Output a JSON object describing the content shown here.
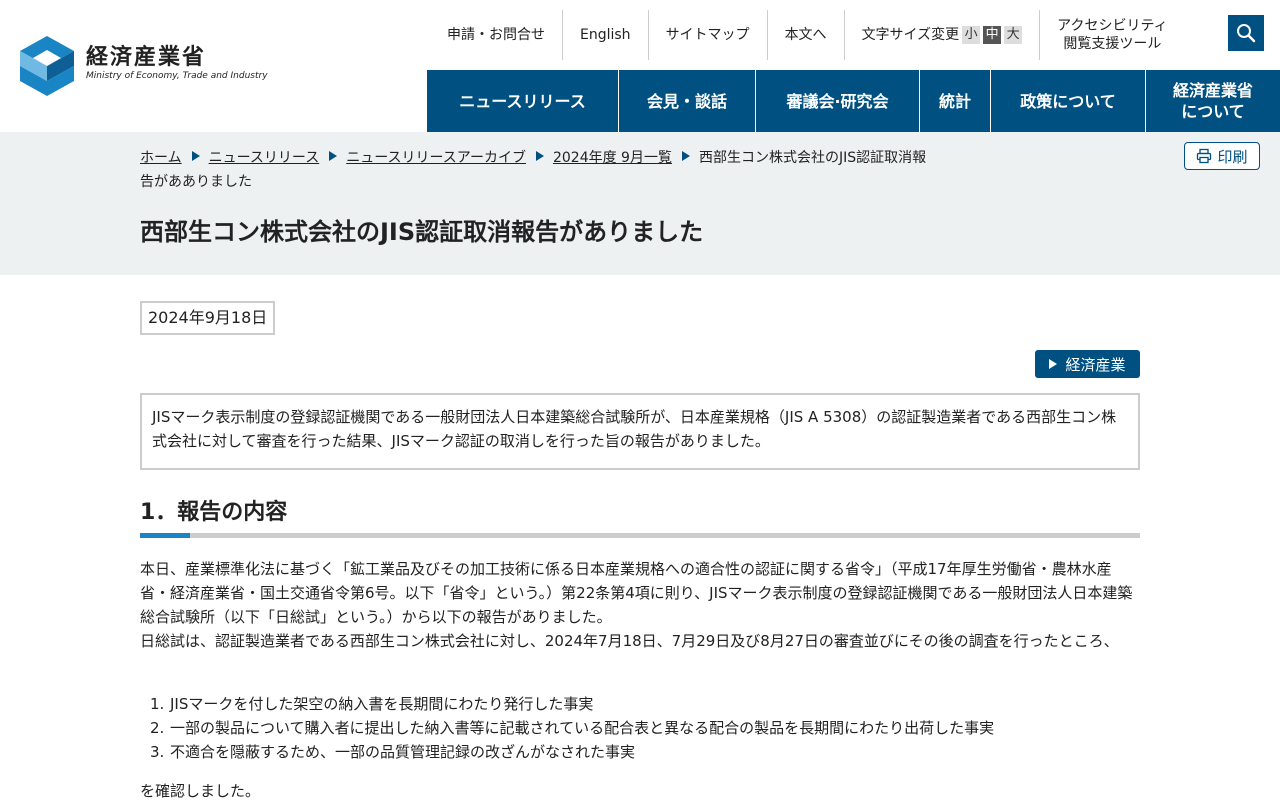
{
  "header": {
    "logo_ja": "経済産業省",
    "logo_en": "Ministry of Economy, Trade and Industry",
    "util": {
      "contact": "申請・お問合せ",
      "english": "English",
      "sitemap": "サイトマップ",
      "skip": "本文へ",
      "font_size_label": "文字サイズ変更",
      "font_small": "小",
      "font_medium": "中",
      "font_large": "大",
      "accessibility_line1": "アクセシビリティ",
      "accessibility_line2": "閲覧支援ツール"
    },
    "gnav": [
      {
        "label": "ニュースリリース"
      },
      {
        "label": "会見・談話"
      },
      {
        "label": "審議会·研究会"
      },
      {
        "label": "統計"
      },
      {
        "label": "政策について"
      },
      {
        "label_line1": "経済産業省",
        "label_line2": "について"
      }
    ]
  },
  "breadcrumb": {
    "items": [
      "ホーム",
      "ニュースリリース",
      "ニュースリリースアーカイブ",
      "2024年度 9月一覧"
    ],
    "current": "西部生コン株式会社のJIS認証取消報告があありました"
  },
  "print_label": "印刷",
  "page_title": "西部生コン株式会社のJIS認証取消報告がありました",
  "date": "2024年9月18日",
  "tag": "経済産業",
  "summary": "JISマーク表示制度の登録認証機関である一般財団法人日本建築総合試験所が、日本産業規格（JIS A 5308）の認証製造業者である西部生コン株式会社に対して審査を行った結果、JISマーク認証の取消しを行った旨の報告がありました。",
  "section1": {
    "heading": "1．報告の内容",
    "para1": "本日、産業標準化法に基づく「鉱工業品及びその加工技術に係る日本産業規格への適合性の認証に関する省令」（平成17年厚生労働省・農林水産省・経済産業省・国土交通省令第6号。以下「省令」という。）第22条第4項に則り、JISマーク表示制度の登録認証機関である一般財団法人日本建築総合試験所（以下「日総試」という。）から以下の報告がありました。",
    "para2": "日総試は、認証製造業者である西部生コン株式会社に対し、2024年7月18日、7月29日及び8月27日の審査並びにその後の調査を行ったところ、",
    "list": [
      {
        "num": "1.",
        "text": "JISマークを付した架空の納入書を長期間にわたり発行した事実"
      },
      {
        "num": "2.",
        "text": "一部の製品について購入者に提出した納入書等に記載されている配合表と異なる配合の製品を長期間にわたり出荷した事実"
      },
      {
        "num": "3.",
        "text": "不適合を隠蔽するため、一部の品質管理記録の改ざんがなされた事実"
      }
    ],
    "closing": "を確認しました。"
  }
}
